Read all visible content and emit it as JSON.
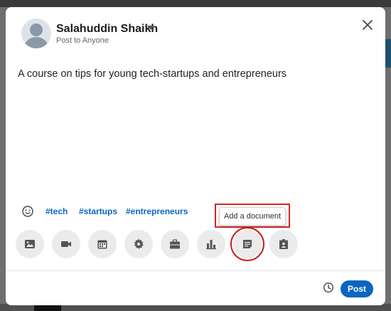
{
  "author": {
    "name": "Salahuddin Shaikh",
    "visibility": "Post to Anyone"
  },
  "post": {
    "text": "A course on tips for young tech-startups and entrepreneurs"
  },
  "hashtags": [
    "#tech",
    "#startups",
    "#entrepreneurs"
  ],
  "tooltip": {
    "text": "Add a document"
  },
  "attachments": [
    "photo-icon",
    "video-icon",
    "event-icon",
    "celebrate-icon",
    "job-icon",
    "poll-icon",
    "document-icon",
    "hiring-icon"
  ],
  "footer": {
    "post_label": "Post"
  },
  "colors": {
    "accent": "#0a66c2",
    "highlight": "#d32424"
  }
}
